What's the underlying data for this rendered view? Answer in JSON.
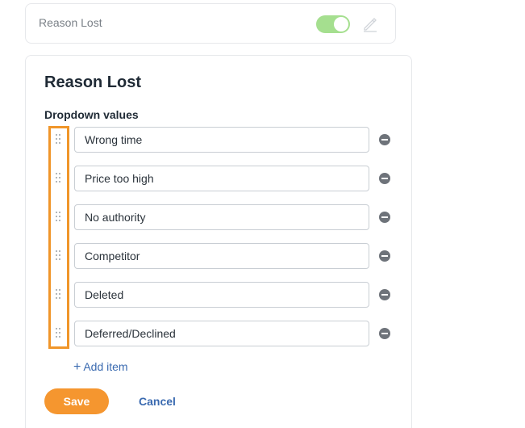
{
  "top_card": {
    "title": "Reason Lost",
    "toggle_on": true,
    "toggle_color": "#a5df8f"
  },
  "editor": {
    "title": "Reason Lost",
    "section_label": "Dropdown values",
    "values": [
      "Wrong time",
      "Price too high",
      "No authority",
      "Competitor",
      "Deleted",
      "Deferred/Declined"
    ],
    "add_item_label": "Add item",
    "save_label": "Save",
    "cancel_label": "Cancel"
  },
  "colors": {
    "accent_orange": "#f5962f",
    "link_blue": "#3a6ab0",
    "highlight_border": "#f0962a"
  },
  "icons": {
    "edit": "pencil-icon",
    "drag": "drag-handle-icon",
    "remove": "minus-circle-icon",
    "add": "plus-icon"
  }
}
